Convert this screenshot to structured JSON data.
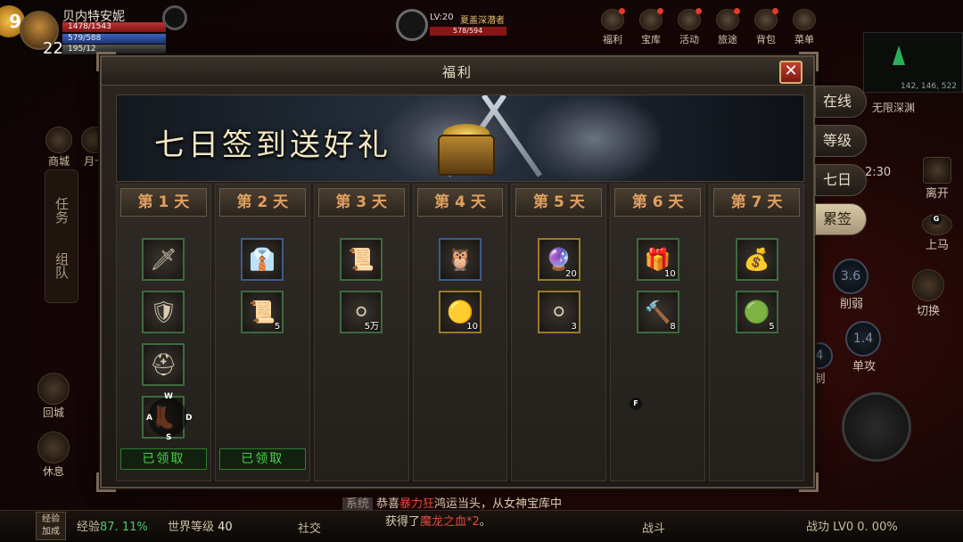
{
  "hud": {
    "level_badge": "9",
    "player_name": "贝内特安妮",
    "hp": "1478/1543",
    "mp": "579/588",
    "xp": "195/12",
    "player_level": "22",
    "target_level": "LV:20",
    "target_name": "夏盖深潜者",
    "target_hp": "578/594",
    "minimap_coords": "142, 146, 522",
    "map_name": "无限深渊",
    "time": "2:30"
  },
  "top_menu": [
    {
      "label": "福利",
      "icon": "gift-icon"
    },
    {
      "label": "宝库",
      "icon": "treasure-icon"
    },
    {
      "label": "活动",
      "icon": "event-icon"
    },
    {
      "label": "旅途",
      "icon": "journey-icon"
    },
    {
      "label": "背包",
      "icon": "bag-icon"
    },
    {
      "label": "菜单",
      "icon": "menu-icon"
    }
  ],
  "left_side": {
    "shop": "商城",
    "monthly_card": "月卡",
    "task_tab": "任务",
    "team_tab": "组队",
    "return_city": "回城",
    "rest": "休息"
  },
  "right_side": {
    "leave": "离开",
    "mount": "上马",
    "weaken_value": "3.6",
    "weaken_label": "削弱",
    "switch": "切换",
    "single_value": "1.4",
    "single_label": "单攻",
    "heal_value": "4",
    "heal_label": "制"
  },
  "dialog": {
    "title": "福利",
    "close_label": "✕",
    "banner_title": "七日签到送好礼",
    "days": [
      {
        "label": "第 1 天",
        "items": [
          {
            "icon": "sword-icon",
            "glyph": "🗡",
            "qty": "",
            "frame": "green"
          },
          {
            "icon": "armor-icon",
            "glyph": "🛡",
            "qty": "",
            "frame": "green"
          },
          {
            "icon": "helmet-icon",
            "glyph": "⛑",
            "qty": "",
            "frame": "green"
          },
          {
            "icon": "boots-icon",
            "glyph": "👢",
            "qty": "",
            "frame": "green"
          }
        ],
        "claimed": "已领取"
      },
      {
        "label": "第 2 天",
        "items": [
          {
            "icon": "suit-icon",
            "glyph": "👔",
            "qty": "",
            "frame": "blue"
          },
          {
            "icon": "scroll-icon",
            "glyph": "📜",
            "qty": "5",
            "frame": "green"
          }
        ],
        "claimed": "已领取"
      },
      {
        "label": "第 3 天",
        "items": [
          {
            "icon": "map-scroll-icon",
            "glyph": "📜",
            "qty": "",
            "frame": "green"
          },
          {
            "icon": "silver-coin-icon",
            "glyph": "⚪",
            "qty": "5万",
            "frame": "green"
          }
        ],
        "claimed": ""
      },
      {
        "label": "第 4 天",
        "items": [
          {
            "icon": "owl-pet-icon",
            "glyph": "🦉",
            "qty": "",
            "frame": "blue"
          },
          {
            "icon": "gold-coin-icon",
            "glyph": "🟡",
            "qty": "10",
            "frame": "gold"
          }
        ],
        "claimed": ""
      },
      {
        "label": "第 5 天",
        "items": [
          {
            "icon": "red-crystal-icon",
            "glyph": "🔮",
            "qty": "20",
            "frame": "gold"
          },
          {
            "icon": "silver-medal-icon",
            "glyph": "⚪",
            "qty": "3",
            "frame": "gold"
          }
        ],
        "claimed": ""
      },
      {
        "label": "第 6 天",
        "items": [
          {
            "icon": "gift-box-icon",
            "glyph": "🎁",
            "qty": "10",
            "frame": "green"
          },
          {
            "icon": "hammer-icon",
            "glyph": "🔨",
            "qty": "8",
            "frame": "green"
          }
        ],
        "claimed": ""
      },
      {
        "label": "第 7 天",
        "items": [
          {
            "icon": "treasure-chest-icon",
            "glyph": "💰",
            "qty": "",
            "frame": "green"
          },
          {
            "icon": "green-pouch-icon",
            "glyph": "🟢",
            "qty": "5",
            "frame": "green"
          }
        ],
        "claimed": ""
      }
    ]
  },
  "right_tabs": [
    {
      "label": "在线",
      "active": false
    },
    {
      "label": "等级",
      "active": false
    },
    {
      "label": "七日",
      "active": false
    },
    {
      "label": "累签",
      "active": true
    }
  ],
  "joystick": {
    "w": "W",
    "a": "A",
    "s": "S",
    "d": "D"
  },
  "f_key": "F",
  "g_key": "G",
  "bottom": {
    "exp_button_line1": "经验",
    "exp_button_line2": "加成",
    "exp_label": "经验",
    "exp_value": "87. 11%",
    "world_level_label": "世界等级",
    "world_level_value": "40",
    "social": "社交",
    "chat_tag": "系统",
    "chat_line1_a": "恭喜",
    "chat_line1_name": "暴力狂",
    "chat_line1_b": "鸿运当头，从女神宝库中",
    "chat_line2_a": "获得了",
    "chat_line2_item": "魔龙之血*2",
    "chat_line2_b": "。",
    "battle": "战斗",
    "merit": "战功 LV0",
    "merit_value": "0. 00%"
  }
}
